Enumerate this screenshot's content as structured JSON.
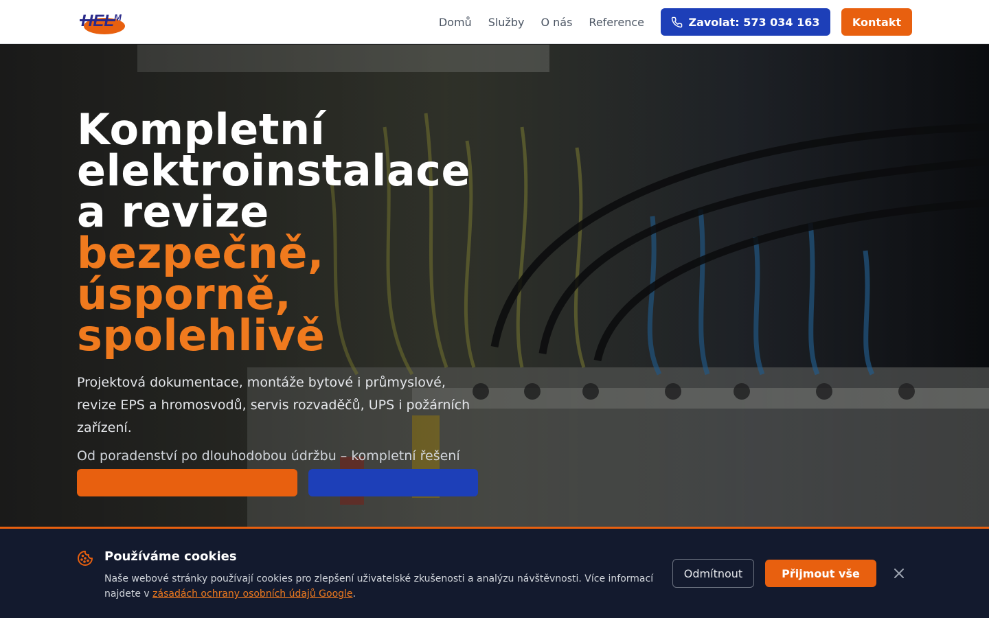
{
  "header": {
    "logo_alt": "HELM",
    "nav": [
      "Domů",
      "Služby",
      "O nás",
      "Reference"
    ],
    "call_label": "Zavolat: 573 034 163",
    "contact_label": "Kontakt"
  },
  "hero": {
    "title_lines": [
      "Kompletní",
      "elektroinstalace",
      "a revize"
    ],
    "accent_lines": [
      "bezpečně,",
      "úsporně,",
      "spolehlivě"
    ],
    "paragraph1": "Projektová dokumentace, montáže bytové i průmyslové, revize EPS a hromosvodů, servis rozvaděčů, UPS i požárních zařízení.",
    "paragraph2": "Od poradenství po dlouhodobou údržbu – kompletní řešení na jednom místě."
  },
  "cookie": {
    "title": "Používáme cookies",
    "text_before": "Naše webové stránky používají cookies pro zlepšení uživatelské zkušenosti a analýzu návštěvnosti. Více informací najdete v ",
    "link_text": "zásadách ochrany osobních údajů Google",
    "text_after": ".",
    "reject_label": "Odmítnout",
    "accept_label": "Přijmout vše"
  },
  "colors": {
    "brand_orange": "#e8600f",
    "brand_blue": "#1d3fb8",
    "cookie_bg": "#131a2e"
  }
}
